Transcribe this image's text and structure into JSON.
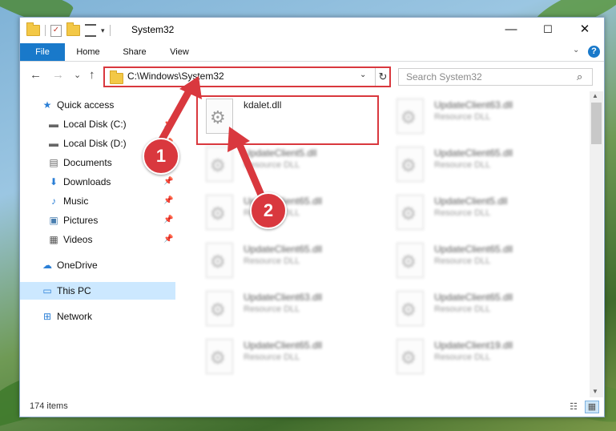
{
  "window": {
    "title": "System32"
  },
  "win_controls": {
    "minimize": "—",
    "maximize": "☐",
    "close": "✕"
  },
  "ribbon": {
    "tabs": [
      "File",
      "Home",
      "Share",
      "View"
    ],
    "help": "?"
  },
  "nav": {
    "back": "←",
    "forward": "→",
    "recent": "⌄",
    "up": "↑"
  },
  "address": {
    "path": "C:\\Windows\\System32"
  },
  "search": {
    "placeholder": "Search System32"
  },
  "sidebar": {
    "items": [
      {
        "label": "Quick access",
        "icon": "star-icon",
        "glyph": "★"
      },
      {
        "label": "Local Disk (C:)",
        "icon": "drive-icon",
        "glyph": "▬"
      },
      {
        "label": "Local Disk (D:)",
        "icon": "drive-icon",
        "glyph": "▬"
      },
      {
        "label": "Documents",
        "icon": "documents-icon",
        "glyph": "▤"
      },
      {
        "label": "Downloads",
        "icon": "download-icon",
        "glyph": "⬇"
      },
      {
        "label": "Music",
        "icon": "music-icon",
        "glyph": "♪"
      },
      {
        "label": "Pictures",
        "icon": "pictures-icon",
        "glyph": "▣"
      },
      {
        "label": "Videos",
        "icon": "videos-icon",
        "glyph": "▦"
      },
      {
        "label": "OneDrive",
        "icon": "cloud-icon",
        "glyph": "☁"
      },
      {
        "label": "This PC",
        "icon": "computer-icon",
        "glyph": "▭"
      },
      {
        "label": "Network",
        "icon": "network-icon",
        "glyph": "⊞"
      }
    ]
  },
  "files": [
    {
      "name": "kdalet.dll",
      "type": ""
    },
    {
      "name": "UpdateClient63.dll",
      "type": "Resource DLL"
    },
    {
      "name": "UpdateClient5.dll",
      "type": "Resource DLL"
    },
    {
      "name": "UpdateClient65.dll",
      "type": "Resource DLL"
    },
    {
      "name": "UpdateClient65.dll",
      "type": "Resource DLL"
    },
    {
      "name": "UpdateClient5.dll",
      "type": "Resource DLL"
    },
    {
      "name": "UpdateClient65.dll",
      "type": "Resource DLL"
    },
    {
      "name": "UpdateClient65.dll",
      "type": "Resource DLL"
    },
    {
      "name": "UpdateClient63.dll",
      "type": "Resource DLL"
    },
    {
      "name": "UpdateClient65.dll",
      "type": "Resource DLL"
    },
    {
      "name": "UpdateClient65.dll",
      "type": "Resource DLL"
    },
    {
      "name": "UpdateClient19.dll",
      "type": "Resource DLL"
    }
  ],
  "status": {
    "count": "174 items"
  },
  "callouts": [
    "1",
    "2"
  ],
  "colors": {
    "accent": "#1979ca",
    "highlight": "#d9383e",
    "selection": "#cce8ff"
  }
}
